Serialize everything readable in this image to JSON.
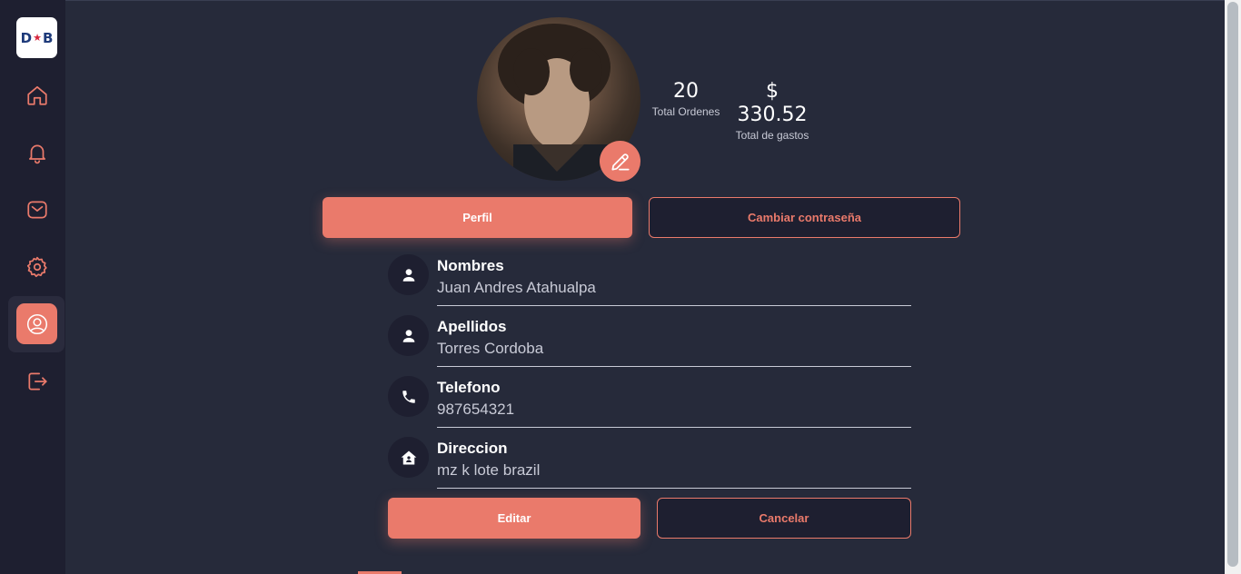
{
  "sidebar": {
    "logo_text_left": "D",
    "logo_star": "★",
    "logo_text_right": "B",
    "items": [
      {
        "icon": "home-icon"
      },
      {
        "icon": "bell-icon"
      },
      {
        "icon": "mail-icon"
      },
      {
        "icon": "gear-icon"
      },
      {
        "icon": "user-circle-icon",
        "active": true
      },
      {
        "icon": "logout-icon"
      }
    ]
  },
  "profile": {
    "stats": [
      {
        "value": "20",
        "label": "Total Ordenes"
      },
      {
        "value": "$ 330.52",
        "label": "Total de gastos"
      }
    ]
  },
  "tabs": {
    "profile_label": "Perfil",
    "password_label": "Cambiar contraseña"
  },
  "fields": [
    {
      "label": "Nombres",
      "value": "Juan Andres Atahualpa",
      "icon": "user-icon"
    },
    {
      "label": "Apellidos",
      "value": "Torres Cordoba",
      "icon": "user-icon"
    },
    {
      "label": "Telefono",
      "value": "987654321",
      "icon": "phone-icon"
    },
    {
      "label": "Direccion",
      "value": "mz k lote brazil",
      "icon": "house-icon"
    }
  ],
  "actions": {
    "edit_label": "Editar",
    "cancel_label": "Cancelar"
  },
  "colors": {
    "accent": "#ea7a6b",
    "background": "#262a3a",
    "sidebar": "#1e1f30"
  }
}
